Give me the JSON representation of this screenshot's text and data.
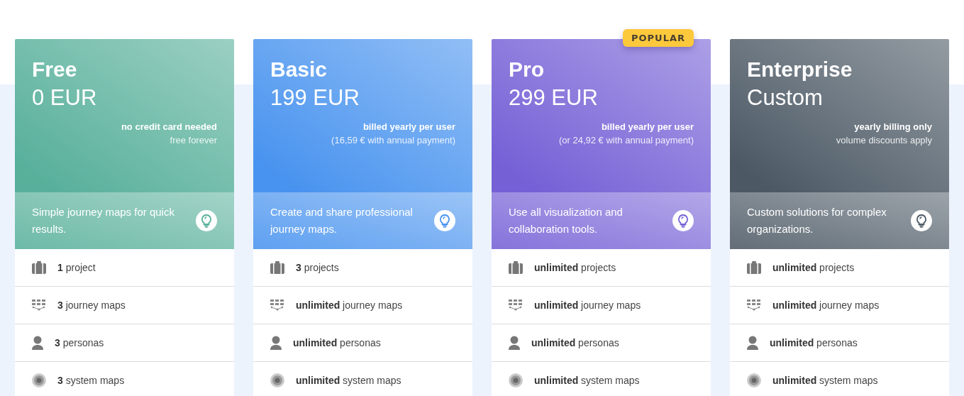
{
  "plans": [
    {
      "name": "Free",
      "price": "0 EUR",
      "color": "#58b09b",
      "billing": "no credit card needed",
      "note": "free forever",
      "tagline": "Simple journey maps for quick results.",
      "features": [
        {
          "kind": "project",
          "text": "**1** project"
        },
        {
          "kind": "journey",
          "text": "**3** journey maps"
        },
        {
          "kind": "persona",
          "text": "**3** personas"
        },
        {
          "kind": "system",
          "text": "**3** system maps"
        }
      ]
    },
    {
      "name": "Basic",
      "price": "199 EUR",
      "color": "#4893ef",
      "billing": "billed yearly per user",
      "note": "(16,59 € with annual payment)",
      "tagline": "Create and share professional journey maps.",
      "features": [
        {
          "kind": "project",
          "text": "**3** projects"
        },
        {
          "kind": "journey",
          "text": "**unlimited** journey maps"
        },
        {
          "kind": "persona",
          "text": "**unlimited** personas"
        },
        {
          "kind": "system",
          "text": "**unlimited** system maps"
        }
      ]
    },
    {
      "name": "Pro",
      "price": "299 EUR",
      "color": "#7560d6",
      "badge": "POPULAR",
      "billing": "billed yearly per user",
      "note": "(or 24,92 € with annual payment)",
      "tagline": "Use all visualization and collaboration tools.",
      "features": [
        {
          "kind": "project",
          "text": "**unlimited** projects"
        },
        {
          "kind": "journey",
          "text": "**unlimited** journey maps"
        },
        {
          "kind": "persona",
          "text": "**unlimited** personas"
        },
        {
          "kind": "system",
          "text": "**unlimited** system maps"
        }
      ]
    },
    {
      "name": "Enterprise",
      "price": "Custom",
      "color": "#4c5965",
      "billing": "yearly billing only",
      "note": "volume discounts apply",
      "tagline": "Custom solutions for complex organizations.",
      "features": [
        {
          "kind": "project",
          "text": "**unlimited** projects"
        },
        {
          "kind": "journey",
          "text": "**unlimited** journey maps"
        },
        {
          "kind": "persona",
          "text": "**unlimited** personas"
        },
        {
          "kind": "system",
          "text": "**unlimited** system maps"
        }
      ]
    }
  ]
}
